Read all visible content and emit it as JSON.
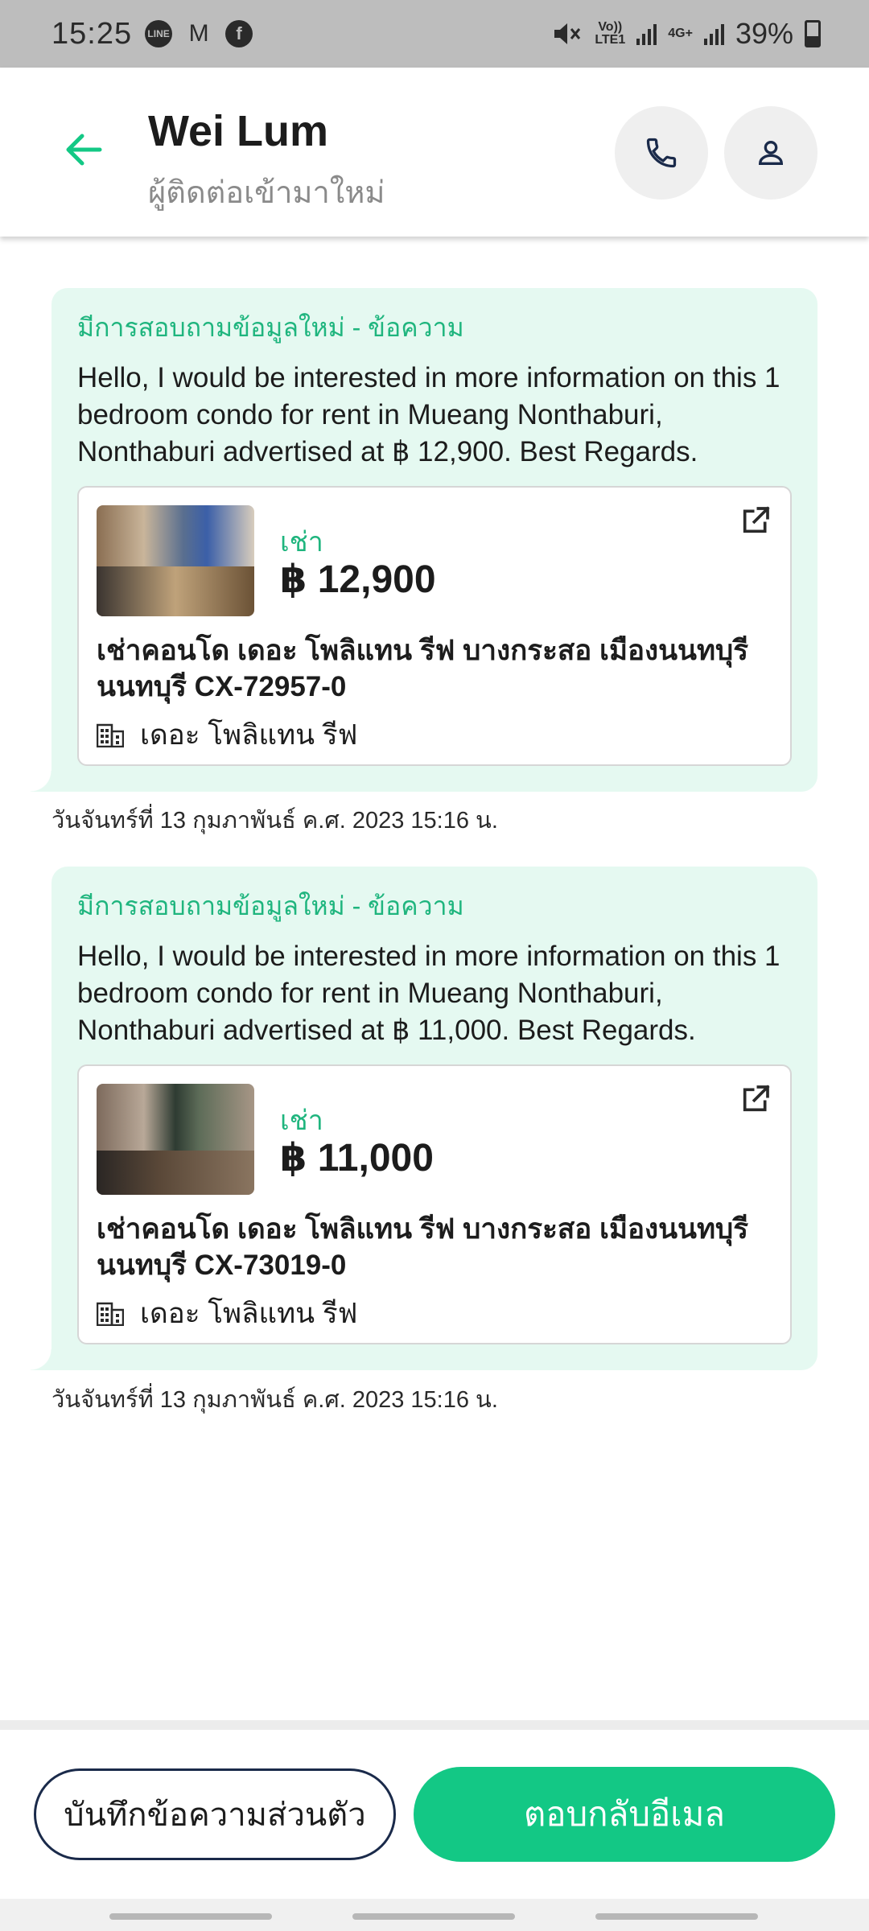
{
  "status_bar": {
    "time": "15:25",
    "left_icons": [
      "line-icon",
      "gmail-icon",
      "facebook-icon"
    ],
    "volte_label": "Vo))",
    "lte_label": "LTE1",
    "network_label": "4G+",
    "battery": "39%"
  },
  "header": {
    "title": "Wei Lum",
    "subtitle": "ผู้ติดต่อเข้ามาใหม่"
  },
  "messages": [
    {
      "subject": "มีการสอบถามข้อมูลใหม่ - ข้อความ",
      "body": "Hello, I would be interested in more information on this 1 bedroom condo for rent in Mueang Nonthaburi, Nonthaburi advertised at ฿ 12,900. Best Regards.",
      "listing": {
        "type": "เช่า",
        "price": "฿ 12,900",
        "title": "เช่าคอนโด  เดอะ โพลิแทน รีฟ บางกระสอ เมืองนนทบุรี นนทบุรี CX-72957-0",
        "project": "เดอะ โพลิแทน รีฟ"
      },
      "timestamp": "วันจันทร์ที่ 13 กุมภาพันธ์ ค.ศ. 2023 15:16 น."
    },
    {
      "subject": "มีการสอบถามข้อมูลใหม่ - ข้อความ",
      "body": "Hello, I would be interested in more information on this 1 bedroom condo for rent in Mueang Nonthaburi, Nonthaburi advertised at ฿ 11,000. Best Regards.",
      "listing": {
        "type": "เช่า",
        "price": "฿ 11,000",
        "title": "เช่าคอนโด  เดอะ โพลิแทน รีฟ บางกระสอ เมืองนนทบุรี นนทบุรี CX-73019-0",
        "project": "เดอะ โพลิแทน รีฟ"
      },
      "timestamp": "วันจันทร์ที่ 13 กุมภาพันธ์ ค.ศ. 2023 15:16 น."
    }
  ],
  "actions": {
    "note_label": "บันทึกข้อความส่วนตัว",
    "reply_label": "ตอบกลับอีเมล"
  },
  "colors": {
    "accent": "#13c885",
    "accent_text": "#1fb57e",
    "message_bg": "#e5f9f1",
    "note_border": "#1a2a4a"
  }
}
